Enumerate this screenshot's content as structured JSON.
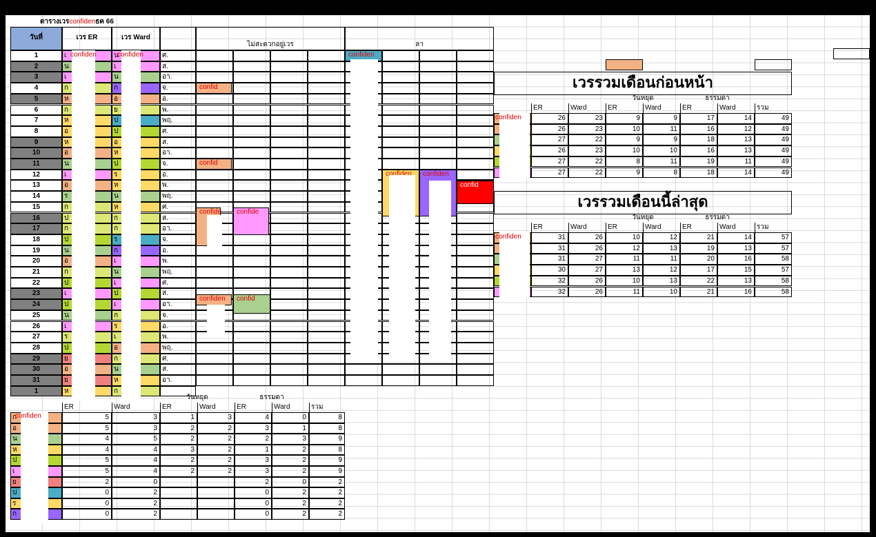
{
  "sheet": {
    "title_prefix": "ตารางเวร",
    "title_conf": "confiden",
    "title_suffix": "ธค 66",
    "headers": {
      "day": "วันที่",
      "er": "เวร ER",
      "ward": "เวร Ward",
      "unavailable": "ไม่สะดวกอยู่เวร",
      "leave": "ลา"
    },
    "confidential": "confiden",
    "confidential_short": "confid",
    "confidential_short2": "confide"
  },
  "schedule": [
    {
      "day": "1",
      "dow": "ศ.",
      "weekend": false,
      "er_code": "เ",
      "ward_code": "น"
    },
    {
      "day": "2",
      "dow": "ส.",
      "weekend": true,
      "er_code": "น",
      "ward_code": "เ"
    },
    {
      "day": "3",
      "dow": "อา.",
      "weekend": true,
      "er_code": "เ",
      "ward_code": "น"
    },
    {
      "day": "4",
      "dow": "จ.",
      "weekend": false,
      "er_code": "ก",
      "ward_code": "ก"
    },
    {
      "day": "5",
      "dow": "อ.",
      "weekend": true,
      "er_code": "ห",
      "ward_code": "อ"
    },
    {
      "day": "6",
      "dow": "พ.",
      "weekend": false,
      "er_code": "ก",
      "ward_code": "ย"
    },
    {
      "day": "7",
      "dow": "พฤ.",
      "weekend": false,
      "er_code": "ห",
      "ward_code": "ป"
    },
    {
      "day": "8",
      "dow": "ศ.",
      "weekend": false,
      "er_code": "อ",
      "ward_code": "ป"
    },
    {
      "day": "9",
      "dow": "ส.",
      "weekend": true,
      "er_code": "ห",
      "ward_code": "อ"
    },
    {
      "day": "10",
      "dow": "อา.",
      "weekend": true,
      "er_code": "อ",
      "ward_code": "ห"
    },
    {
      "day": "11",
      "dow": "จ.",
      "weekend": true,
      "er_code": "น",
      "ward_code": "ป"
    },
    {
      "day": "12",
      "dow": "อ.",
      "weekend": false,
      "er_code": "เ",
      "ward_code": "ร"
    },
    {
      "day": "13",
      "dow": "พ.",
      "weekend": false,
      "er_code": "อ",
      "ward_code": "ห"
    },
    {
      "day": "14",
      "dow": "พฤ.",
      "weekend": false,
      "er_code": "ร",
      "ward_code": "น"
    },
    {
      "day": "15",
      "dow": "ศ.",
      "weekend": false,
      "er_code": "ก",
      "ward_code": "ห"
    },
    {
      "day": "16",
      "dow": "ส.",
      "weekend": true,
      "er_code": "ป",
      "ward_code": "ก"
    },
    {
      "day": "17",
      "dow": "อา.",
      "weekend": true,
      "er_code": "ก",
      "ward_code": "ก"
    },
    {
      "day": "18",
      "dow": "จ.",
      "weekend": false,
      "er_code": "ป",
      "ward_code": "ร"
    },
    {
      "day": "19",
      "dow": "อ.",
      "weekend": false,
      "er_code": "น",
      "ward_code": "ก"
    },
    {
      "day": "20",
      "dow": "พ.",
      "weekend": false,
      "er_code": "อ",
      "ward_code": "เ"
    },
    {
      "day": "21",
      "dow": "พฤ.",
      "weekend": false,
      "er_code": "ก",
      "ward_code": "น"
    },
    {
      "day": "22",
      "dow": "ศ.",
      "weekend": false,
      "er_code": "ป",
      "ward_code": "เ"
    },
    {
      "day": "23",
      "dow": "ส.",
      "weekend": true,
      "er_code": "เ",
      "ward_code": "ป"
    },
    {
      "day": "24",
      "dow": "อา.",
      "weekend": true,
      "er_code": "ป",
      "ward_code": "เ"
    },
    {
      "day": "25",
      "dow": "จ.",
      "weekend": false,
      "er_code": "น",
      "ward_code": "ก"
    },
    {
      "day": "26",
      "dow": "อ.",
      "weekend": false,
      "er_code": "เ",
      "ward_code": "ร"
    },
    {
      "day": "27",
      "dow": "พ.",
      "weekend": false,
      "er_code": "ร",
      "ward_code": "เ"
    },
    {
      "day": "28",
      "dow": "พฤ.",
      "weekend": false,
      "er_code": "ป",
      "ward_code": "อ"
    },
    {
      "day": "29",
      "dow": "ศ.",
      "weekend": true,
      "er_code": "ย",
      "ward_code": "ก"
    },
    {
      "day": "30",
      "dow": "ส.",
      "weekend": true,
      "er_code": "อ",
      "ward_code": "น"
    },
    {
      "day": "31",
      "dow": "อา.",
      "weekend": true,
      "er_code": "ย",
      "ward_code": "ห"
    },
    {
      "day": "1",
      "dow": "",
      "weekend": true,
      "er_code": "ห",
      "ward_code": "ก"
    }
  ],
  "summary_bottom": {
    "group_holiday": "วันหยุด",
    "group_normal": "ธรรมดา",
    "cols": [
      "ER",
      "Ward",
      "ER",
      "Ward",
      "ER",
      "Ward",
      "รวม"
    ],
    "rows": [
      {
        "code": "ก",
        "values": [
          "5",
          "3",
          "1",
          "3",
          "4",
          "0",
          "8"
        ]
      },
      {
        "code": "อ",
        "values": [
          "5",
          "3",
          "2",
          "2",
          "3",
          "1",
          "8"
        ]
      },
      {
        "code": "น",
        "values": [
          "4",
          "5",
          "2",
          "2",
          "2",
          "3",
          "9"
        ]
      },
      {
        "code": "ห",
        "values": [
          "4",
          "4",
          "3",
          "2",
          "1",
          "2",
          "8"
        ]
      },
      {
        "code": "ป",
        "values": [
          "5",
          "4",
          "2",
          "2",
          "3",
          "2",
          "9"
        ]
      },
      {
        "code": "เ",
        "values": [
          "5",
          "4",
          "2",
          "2",
          "3",
          "2",
          "9"
        ]
      },
      {
        "code": "ย",
        "values": [
          "2",
          "0",
          "",
          "",
          "2",
          "0",
          "2"
        ]
      },
      {
        "code": "ป",
        "values": [
          "0",
          "2",
          "",
          "",
          "0",
          "2",
          "2"
        ]
      },
      {
        "code": "ร",
        "values": [
          "0",
          "2",
          "",
          "",
          "0",
          "2",
          "2"
        ]
      },
      {
        "code": "ก",
        "values": [
          "0",
          "2",
          "",
          "",
          "0",
          "2",
          "2"
        ]
      }
    ]
  },
  "prev_month": {
    "title": "เวรรวมเดือนก่อนหน้า",
    "group_holiday": "วันหยุด",
    "group_normal": "ธรรมดา",
    "cols": [
      "ER",
      "Ward",
      "ER",
      "Ward",
      "ER",
      "Ward",
      "รวม"
    ],
    "rows": [
      [
        "26",
        "23",
        "9",
        "9",
        "17",
        "14",
        "49"
      ],
      [
        "26",
        "23",
        "10",
        "11",
        "16",
        "12",
        "49"
      ],
      [
        "27",
        "22",
        "9",
        "9",
        "18",
        "13",
        "49"
      ],
      [
        "26",
        "23",
        "10",
        "10",
        "16",
        "13",
        "49"
      ],
      [
        "27",
        "22",
        "8",
        "11",
        "19",
        "11",
        "49"
      ],
      [
        "27",
        "22",
        "9",
        "8",
        "18",
        "14",
        "49"
      ]
    ]
  },
  "latest": {
    "title": "เวรรวมเดือนนี้ล่าสุด",
    "group_holiday": "วันหยุด",
    "group_normal": "ธรรมดา",
    "cols": [
      "ER",
      "Ward",
      "ER",
      "Ward",
      "ER",
      "Ward",
      "รวม"
    ],
    "rows": [
      [
        "31",
        "26",
        "10",
        "12",
        "21",
        "14",
        "57"
      ],
      [
        "31",
        "26",
        "12",
        "13",
        "19",
        "13",
        "57"
      ],
      [
        "31",
        "27",
        "11",
        "11",
        "20",
        "16",
        "58"
      ],
      [
        "30",
        "27",
        "13",
        "12",
        "17",
        "15",
        "57"
      ],
      [
        "32",
        "26",
        "10",
        "13",
        "22",
        "13",
        "58"
      ],
      [
        "32",
        "26",
        "11",
        "10",
        "21",
        "16",
        "58"
      ]
    ]
  },
  "colors": {
    "day_header": "#8eaadb",
    "weekend_day": "#808080",
    "peach": "#f4b183",
    "pink": "#ff99ff",
    "green": "#a9d08e",
    "yellow": "#ffd966",
    "lime": "#b4d733",
    "teal": "#4bacc6",
    "purple": "#9966ff",
    "salmon": "#f08080",
    "red": "#ff0000",
    "lightyellow": "#dce775"
  }
}
